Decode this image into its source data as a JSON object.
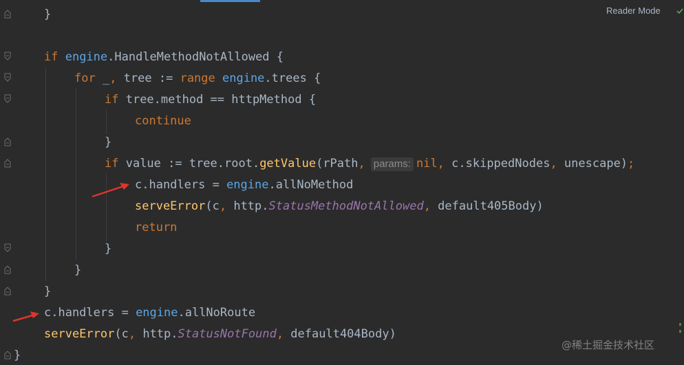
{
  "toolbar": {
    "reader_mode": "Reader Mode"
  },
  "lines": [
    {
      "id": "l1",
      "tokens": [
        {
          "t": "}",
          "c": "id"
        }
      ]
    },
    {
      "id": "l2",
      "tokens": [
        {
          "t": "if ",
          "c": "kw"
        },
        {
          "t": "engine",
          "c": "pkg"
        },
        {
          "t": ".HandleMethodNotAllowed {",
          "c": "id"
        }
      ]
    },
    {
      "id": "l3",
      "tokens": [
        {
          "t": "for ",
          "c": "kw"
        },
        {
          "t": "_",
          "c": "id"
        },
        {
          "t": ", ",
          "c": "punc"
        },
        {
          "t": "tree := ",
          "c": "id"
        },
        {
          "t": "range ",
          "c": "kw"
        },
        {
          "t": "engine",
          "c": "pkg"
        },
        {
          "t": ".trees {",
          "c": "id"
        }
      ]
    },
    {
      "id": "l4",
      "tokens": [
        {
          "t": "if ",
          "c": "kw"
        },
        {
          "t": "tree.method == httpMethod {",
          "c": "id"
        }
      ]
    },
    {
      "id": "l5",
      "tokens": [
        {
          "t": "continue",
          "c": "kw"
        }
      ]
    },
    {
      "id": "l6",
      "tokens": [
        {
          "t": "}",
          "c": "id"
        }
      ]
    },
    {
      "id": "l7",
      "tokens": [
        {
          "t": "if ",
          "c": "kw"
        },
        {
          "t": "value := tree.root.",
          "c": "id"
        },
        {
          "t": "getValue",
          "c": "fn"
        },
        {
          "t": "(rPath",
          "c": "id"
        },
        {
          "t": ",",
          "c": "punc"
        },
        {
          "t": "params:",
          "c": "hint"
        },
        {
          "t": "nil",
          "c": "kw"
        },
        {
          "t": ", ",
          "c": "punc"
        },
        {
          "t": "c.skippedNodes",
          "c": "id"
        },
        {
          "t": ", ",
          "c": "punc"
        },
        {
          "t": "unescape)",
          "c": "id"
        },
        {
          "t": ";",
          "c": "punc"
        }
      ]
    },
    {
      "id": "l8",
      "tokens": [
        {
          "t": "c.handlers = ",
          "c": "id"
        },
        {
          "t": "engine",
          "c": "pkg"
        },
        {
          "t": ".allNoMethod",
          "c": "id"
        }
      ]
    },
    {
      "id": "l9",
      "tokens": [
        {
          "t": "serveError",
          "c": "fn"
        },
        {
          "t": "(c",
          "c": "id"
        },
        {
          "t": ", ",
          "c": "punc"
        },
        {
          "t": "http.",
          "c": "id"
        },
        {
          "t": "StatusMethodNotAllowed",
          "c": "const"
        },
        {
          "t": ", ",
          "c": "punc"
        },
        {
          "t": "default405Body)",
          "c": "id"
        }
      ]
    },
    {
      "id": "l10",
      "tokens": [
        {
          "t": "return",
          "c": "kw"
        }
      ]
    },
    {
      "id": "l11",
      "tokens": [
        {
          "t": "}",
          "c": "id"
        }
      ]
    },
    {
      "id": "l12",
      "tokens": [
        {
          "t": "}",
          "c": "id"
        }
      ]
    },
    {
      "id": "l13",
      "tokens": [
        {
          "t": "}",
          "c": "id"
        }
      ]
    },
    {
      "id": "l14",
      "tokens": [
        {
          "t": "c.handlers = ",
          "c": "id"
        },
        {
          "t": "engine",
          "c": "pkg"
        },
        {
          "t": ".allNoRoute",
          "c": "id"
        }
      ]
    },
    {
      "id": "l15",
      "tokens": [
        {
          "t": "serveError",
          "c": "fn"
        },
        {
          "t": "(c",
          "c": "id"
        },
        {
          "t": ", ",
          "c": "punc"
        },
        {
          "t": "http.",
          "c": "id"
        },
        {
          "t": "StatusNotFound",
          "c": "const"
        },
        {
          "t": ", ",
          "c": "punc"
        },
        {
          "t": "default404Body)",
          "c": "id"
        }
      ]
    },
    {
      "id": "l16",
      "tokens": [
        {
          "t": "}",
          "c": "id"
        }
      ]
    }
  ],
  "watermark": "@稀土掘金技术社区",
  "colors": {
    "background": "#2b2b2b",
    "keyword": "#cc7832",
    "identifier": "#a9b7c6",
    "package": "#5ba6e6",
    "function": "#ffc66d",
    "constant": "#9876aa",
    "annotation_arrow": "#e0352b"
  },
  "icons": {
    "fold": "fold-marker-icon",
    "check": "check-icon",
    "arrow": "red-arrow-icon"
  }
}
